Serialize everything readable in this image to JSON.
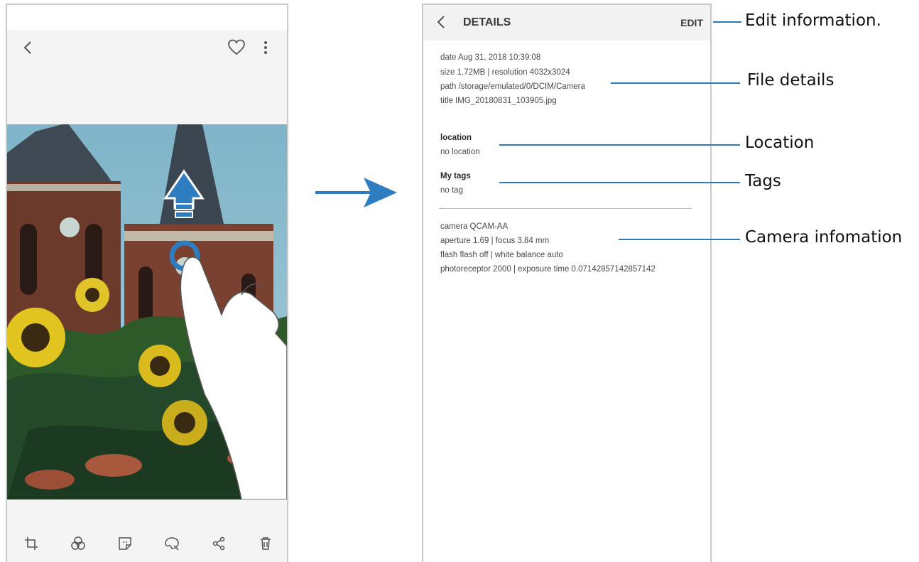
{
  "left_phone": {
    "icons": {
      "back": "back-chevron-icon",
      "favorite": "heart-icon",
      "more": "more-vertical-icon"
    },
    "toolbar": [
      "crop-icon",
      "filter-icon",
      "sticker-icon",
      "palette-icon",
      "share-icon",
      "trash-icon"
    ],
    "gesture": "swipe-up-hand-icon"
  },
  "details": {
    "title": "DETAILS",
    "edit_label": "EDIT",
    "date": "date  Aug 31, 2018 10:39:08",
    "size_resolution": "size  1.72MB   |   resolution  4032x3024",
    "path": "path  /storage/emulated/0/DCIM/Camera",
    "file_title": "title  IMG_20180831_103905.jpg",
    "location_label": "location",
    "location_value": "no location",
    "tags_label": "My tags",
    "tags_value": "no tag",
    "camera": "camera  QCAM-AA",
    "aperture_focus": "aperture  1.69   |   focus  3.84 mm",
    "flash_wb": "flash  flash off   |   white balance  auto",
    "photoreceptor_exposure": "photoreceptor  2000   |   exposure time  0.07142857142857142"
  },
  "callouts": {
    "edit": "Edit information.",
    "file": "File details",
    "location": "Location",
    "tags": "Tags",
    "camera": "Camera infomation"
  },
  "colors": {
    "accent": "#2c7ab8",
    "arrow": "#2d7dc0"
  }
}
